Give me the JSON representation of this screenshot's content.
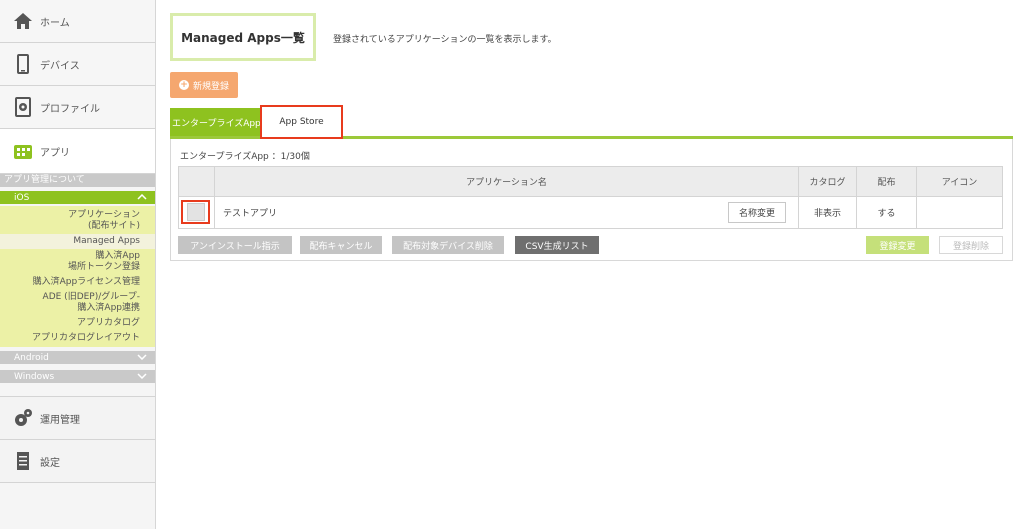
{
  "sidebar": {
    "nav_top": [
      {
        "label": "ホーム",
        "icon": "home-icon"
      },
      {
        "label": "デバイス",
        "icon": "device-icon"
      },
      {
        "label": "プロファイル",
        "icon": "profile-icon"
      },
      {
        "label": "アプリ",
        "icon": "app-icon"
      }
    ],
    "sub_header": "アプリ管理について",
    "ios_label": "iOS",
    "ios_items": [
      "アプリケーション\n(配布サイト)",
      "Managed Apps",
      "購入済App\n場所トークン登録",
      "購入済Appライセンス管理",
      "ADE (旧DEP)/グループ-\n購入済App連携",
      "アプリカタログ",
      "アプリカタログレイアウト"
    ],
    "android_label": "Android",
    "windows_label": "Windows",
    "nav_bottom": [
      {
        "label": "運用管理",
        "icon": "gears-icon"
      },
      {
        "label": "設定",
        "icon": "settings-doc-icon"
      }
    ]
  },
  "main": {
    "title": "Managed Apps一覧",
    "description": "登録されているアプリケーションの一覧を表示します。",
    "new_button": "新規登録",
    "tabs": [
      "エンタープライズApp",
      "App Store"
    ],
    "count_label": "エンタープライズApp ：1/30個",
    "table": {
      "headers": [
        "アプリケーション名",
        "カタログ",
        "配布",
        "アイコン"
      ],
      "rows": [
        {
          "name": "テストアプリ",
          "rename": "名称変更",
          "catalog": "非表示",
          "distribute": "する",
          "icon": ""
        }
      ]
    },
    "actions": {
      "uninstall": "アンインストール指示",
      "cancel": "配布キャンセル",
      "delete_targets": "配布対象デバイス削除",
      "csv": "CSV生成リスト",
      "update": "登録変更",
      "delete": "登録削除"
    }
  },
  "colors": {
    "accent": "#8ec21f",
    "highlight": "#e83b1d",
    "orange": "#f5a76f"
  }
}
